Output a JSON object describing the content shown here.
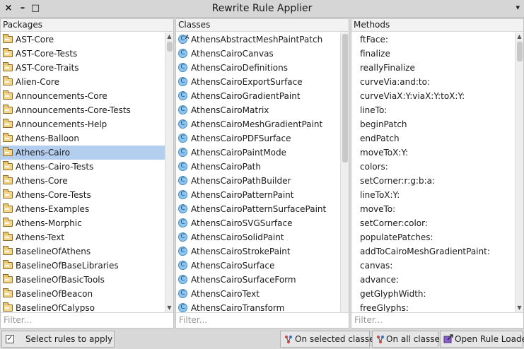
{
  "window": {
    "title": "Rewrite Rule Applier",
    "close_glyph": "×",
    "minimize_glyph": "–",
    "maximize_glyph": "□",
    "menu_glyph": "▾"
  },
  "packages": {
    "header": "Packages",
    "filter_placeholder": "Filter...",
    "selected": "Athens-Cairo",
    "items": [
      "AST-Core",
      "AST-Core-Tests",
      "AST-Core-Traits",
      "Alien-Core",
      "Announcements-Core",
      "Announcements-Core-Tests",
      "Announcements-Help",
      "Athens-Balloon",
      "Athens-Cairo",
      "Athens-Cairo-Tests",
      "Athens-Core",
      "Athens-Core-Tests",
      "Athens-Examples",
      "Athens-Morphic",
      "Athens-Text",
      "BaselineOfAthens",
      "BaselineOfBaseLibraries",
      "BaselineOfBasicTools",
      "BaselineOfBeacon",
      "BaselineOfCalypso"
    ]
  },
  "classes": {
    "header": "Classes",
    "filter_placeholder": "Filter...",
    "class_glyph": "C",
    "abstract_glyph": "A",
    "items": [
      "AthensAbstractMeshPaintPatch",
      "AthensCairoCanvas",
      "AthensCairoDefinitions",
      "AthensCairoExportSurface",
      "AthensCairoGradientPaint",
      "AthensCairoMatrix",
      "AthensCairoMeshGradientPaint",
      "AthensCairoPDFSurface",
      "AthensCairoPaintMode",
      "AthensCairoPath",
      "AthensCairoPathBuilder",
      "AthensCairoPatternPaint",
      "AthensCairoPatternSurfacePaint",
      "AthensCairoSVGSurface",
      "AthensCairoSolidPaint",
      "AthensCairoStrokePaint",
      "AthensCairoSurface",
      "AthensCairoSurfaceForm",
      "AthensCairoText",
      "AthensCairoTransform"
    ]
  },
  "methods": {
    "header": "Methods",
    "filter_placeholder": "Filter...",
    "items": [
      "ftFace:",
      "finalize",
      "reallyFinalize",
      "curveVia:and:to:",
      "curveViaX:Y:viaX:Y:toX:Y:",
      "lineTo:",
      "beginPatch",
      "endPatch",
      "moveToX:Y:",
      "colors:",
      "setCorner:r:g:b:a:",
      "lineToX:Y:",
      "moveTo:",
      "setCorner:color:",
      "populatePatches:",
      "addToCairoMeshGradientPaint:",
      "canvas:",
      "advance:",
      "getGlyphWidth:",
      "freeGlyphs:"
    ]
  },
  "bottom": {
    "select_rules_label": "Select rules to apply",
    "select_rules_checked": true,
    "on_selected_classes_label": "On selected classes",
    "on_all_classes_label": "On all classes",
    "open_rule_loader_label": "Open Rule Loader"
  },
  "colors": {
    "selection": "#b3ceef",
    "class_icon": "#8cc6f0"
  }
}
